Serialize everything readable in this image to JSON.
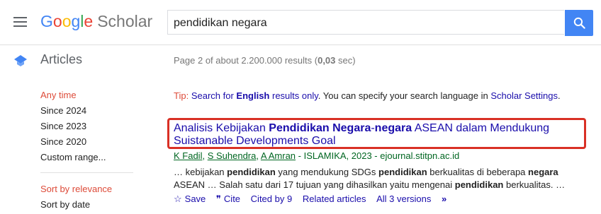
{
  "header": {
    "logo_letters": [
      "G",
      "o",
      "o",
      "g",
      "l",
      "e"
    ],
    "logo_product": "Scholar",
    "search_query": "pendidikan negara"
  },
  "section": {
    "title": "Articles",
    "results_prefix": "Page 2 of about 2.200.000 results (",
    "results_time": "0,03",
    "results_suffix": " sec)"
  },
  "sidebar": {
    "time_filters": [
      "Any time",
      "Since 2024",
      "Since 2023",
      "Since 2020",
      "Custom range..."
    ],
    "sort_options": [
      "Sort by relevance",
      "Sort by date"
    ]
  },
  "tip": {
    "label": "Tip:",
    "link1_before": "Search for ",
    "link1_bold": "English",
    "link1_after": " results only",
    "middle": ". You can specify your search language in ",
    "link2": "Scholar Settings",
    "end": "."
  },
  "result": {
    "title_parts": [
      {
        "text": "Analisis Kebijakan ",
        "bold": false
      },
      {
        "text": "Pendidikan Negara",
        "bold": true
      },
      {
        "text": "-",
        "bold": false
      },
      {
        "text": "negara",
        "bold": true
      },
      {
        "text": " ASEAN dalam Mendukung Suistanable Developments Goal",
        "bold": false
      }
    ],
    "authors": [
      "K Fadil",
      "S Suhendra",
      "A Amran"
    ],
    "source": " - ISLAMIKA, 2023 - ejournal.stitpn.ac.id",
    "snippet_parts": [
      {
        "text": "… kebijakan ",
        "bold": false
      },
      {
        "text": "pendidikan",
        "bold": true
      },
      {
        "text": " yang mendukung SDGs ",
        "bold": false
      },
      {
        "text": "pendidikan",
        "bold": true
      },
      {
        "text": " berkualitas di beberapa ",
        "bold": false
      },
      {
        "text": "negara",
        "bold": true
      },
      {
        "text": " ASEAN … Salah satu dari 17 tujuan yang dihasilkan yaitu mengenai ",
        "bold": false
      },
      {
        "text": "pendidikan",
        "bold": true
      },
      {
        "text": " berkualitas. …",
        "bold": false
      }
    ],
    "actions": {
      "save": "Save",
      "cite": "Cite",
      "cited_by": "Cited by 9",
      "related": "Related articles",
      "versions": "All 3 versions"
    }
  },
  "colors": {
    "link": "#1a0dab",
    "active_filter": "#dd4b39",
    "author_green": "#006621",
    "highlight_red": "#d93025",
    "search_button": "#4285f4"
  }
}
